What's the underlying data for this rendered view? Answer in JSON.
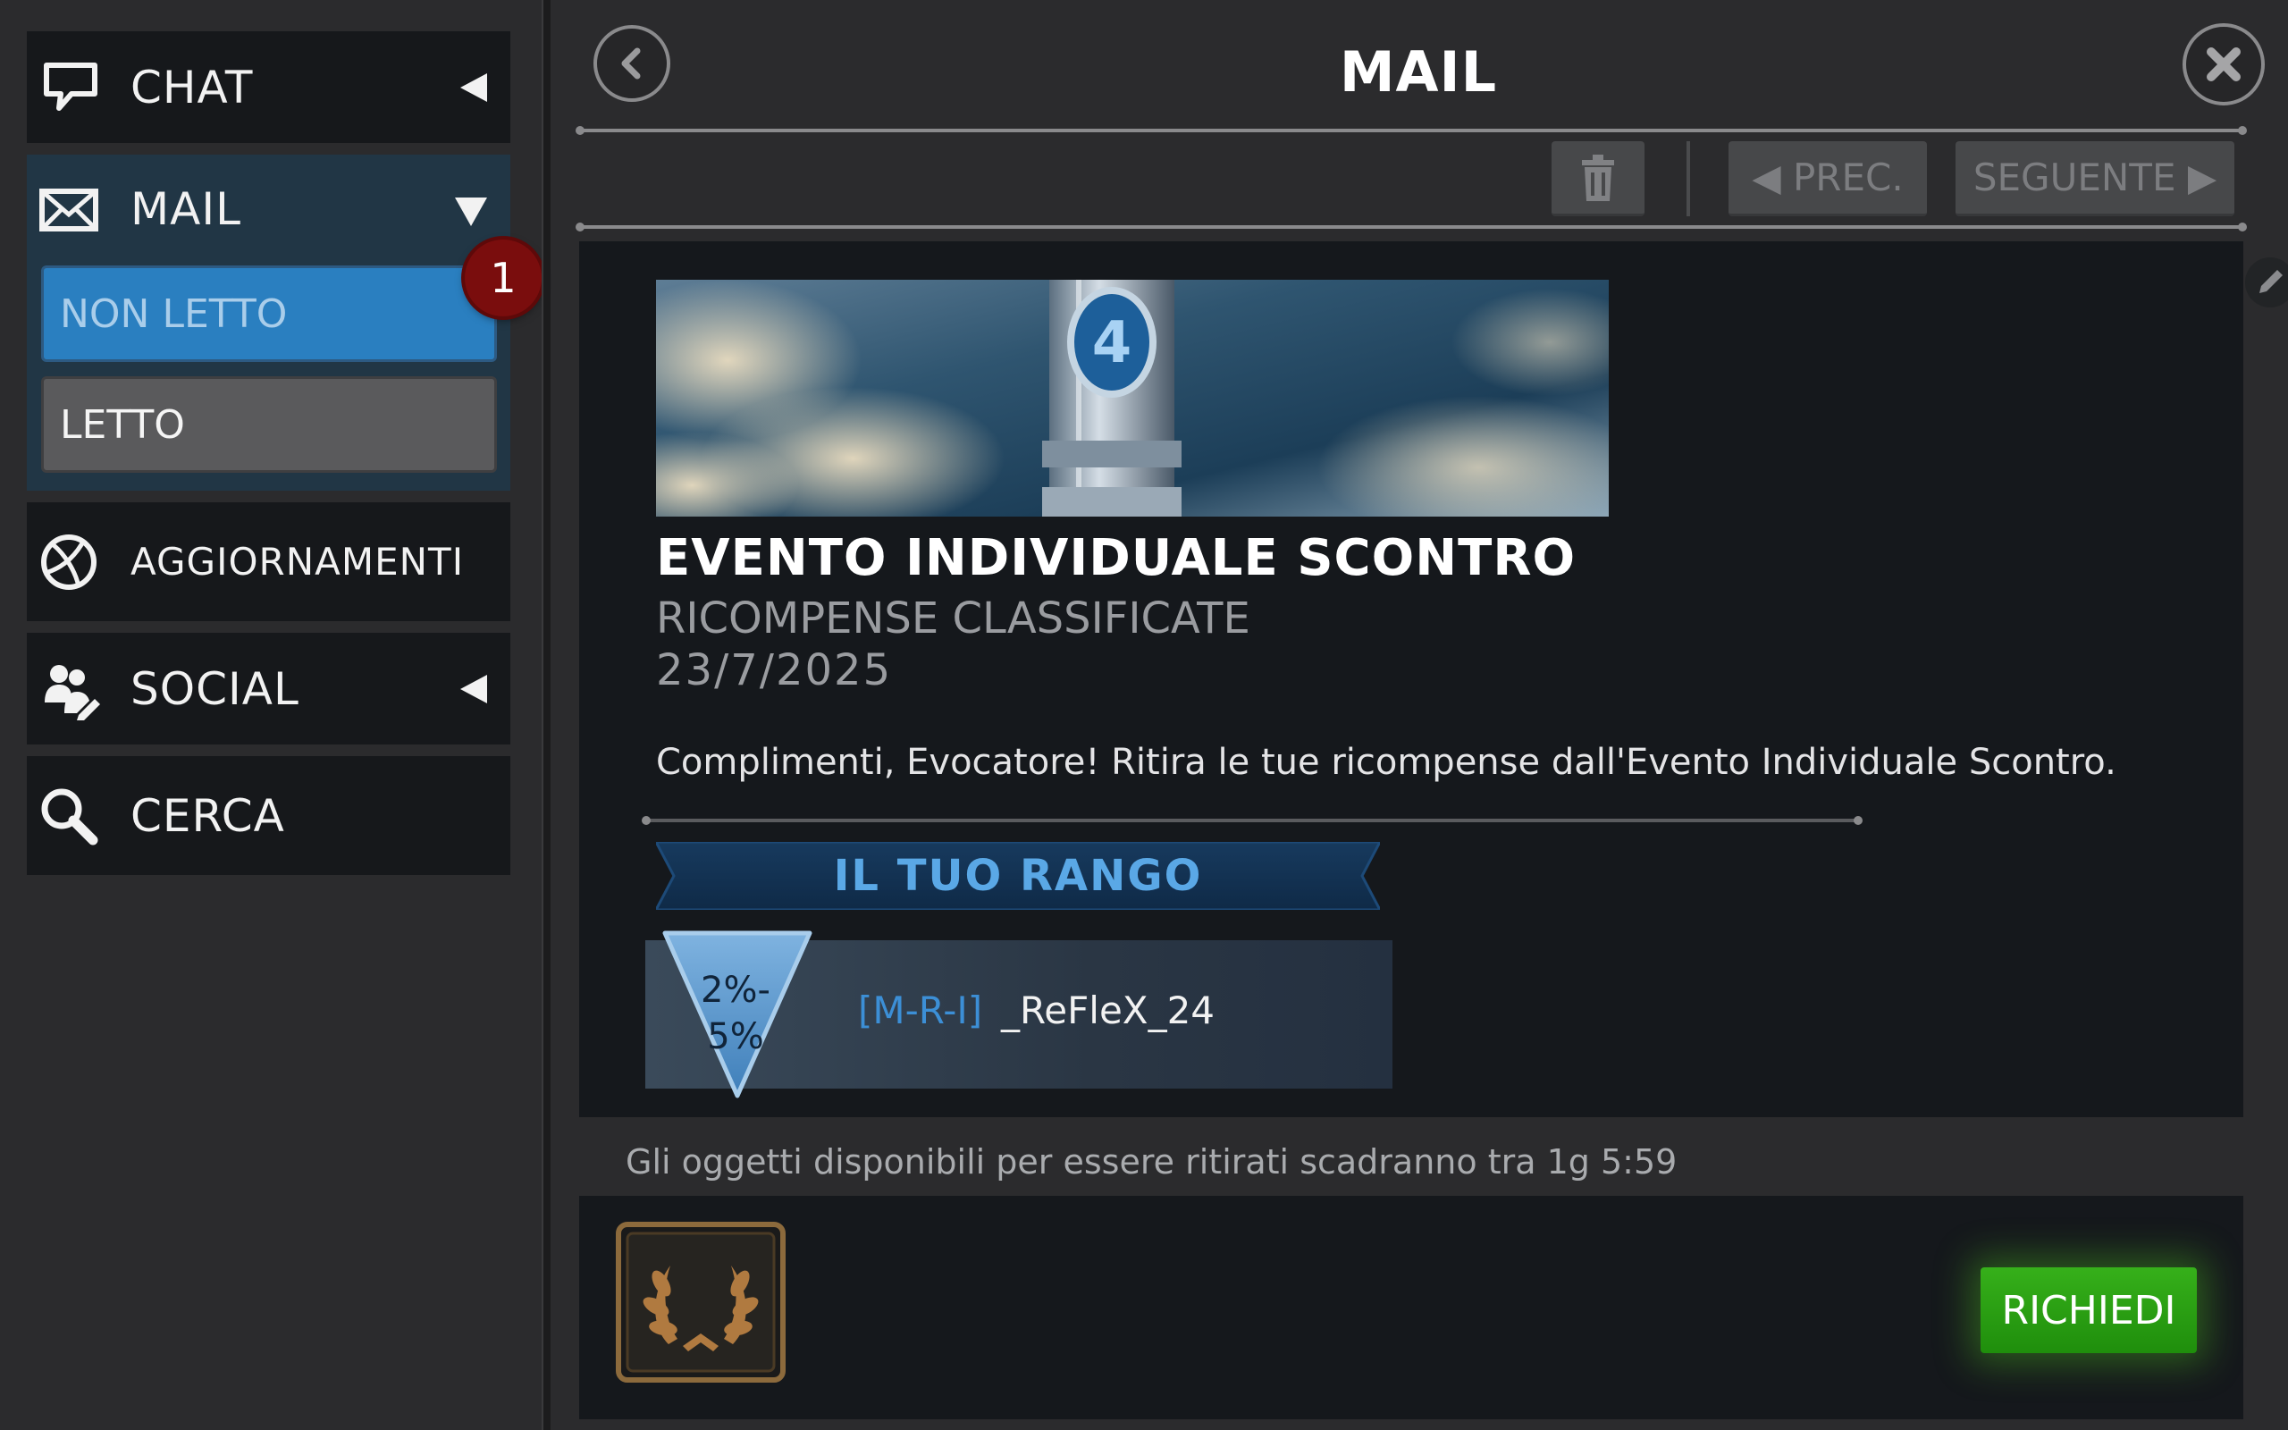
{
  "sidebar": {
    "chat_label": "CHAT",
    "mail_label": "MAIL",
    "unread_label": "NON LETTO",
    "unread_count": "1",
    "read_label": "LETTO",
    "updates_label": "AGGIORNAMENTI",
    "social_label": "SOCIAL",
    "search_label": "CERCA"
  },
  "header": {
    "title": "MAIL"
  },
  "toolbar": {
    "prev_label": "◀ PREC.",
    "next_label": "SEGUENTE ▶"
  },
  "message": {
    "title": "EVENTO INDIVIDUALE SCONTRO",
    "subtitle": "RICOMPENSE CLASSIFICATE",
    "date": "23/7/2025",
    "body": "Complimenti, Evocatore! Ritira le tue ricompense dall'Evento Individuale Scontro.",
    "rank_heading": "IL TUO RANGO",
    "rank_pct_line1": "2%-",
    "rank_pct_line2": "5%",
    "player_tag": "[M-R-I]",
    "player_name": "_ReFleX_24"
  },
  "rewards": {
    "expiry": "Gli oggetti disponibili per essere ritirati scadranno tra 1g 5:59",
    "claim_label": "RICHIEDI"
  },
  "colors": {
    "accent_blue": "#2a7fc0",
    "claim_green": "#2aa014",
    "badge_red": "#7a0d0d"
  }
}
